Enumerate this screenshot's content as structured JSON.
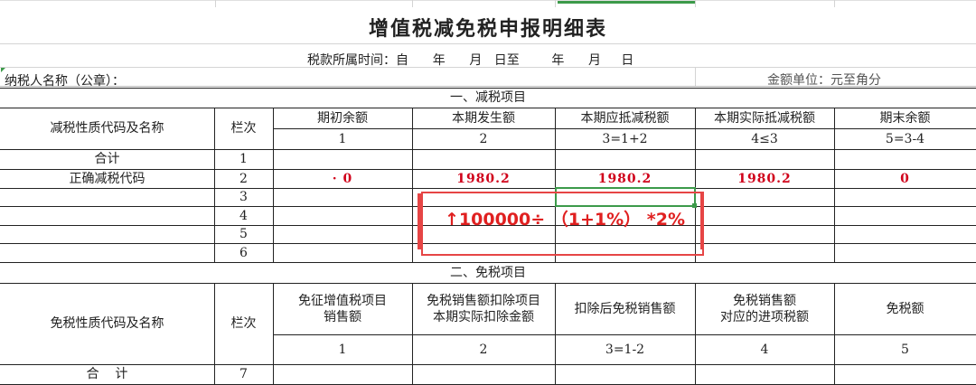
{
  "title": "增值税减免税申报明细表",
  "subtitle": "税款所属时间：自      年      月   日至        年      月     日",
  "taxpayer_label": "纳税人名称（公章）：",
  "unit_label": "金额单位：元至角分",
  "section1": {
    "title": "一、减税项目",
    "name_header": "减税性质代码及名称",
    "row_header": "栏次",
    "columns": [
      "期初余额",
      "本期发生额",
      "本期应抵减税额",
      "本期实际抵减税额",
      "期末余额"
    ],
    "formulas": [
      "1",
      "2",
      "3=1+2",
      "4≤3",
      "5=3-4"
    ],
    "rows": [
      {
        "name": "合计",
        "line": "1",
        "values": [
          "",
          "",
          "",
          "",
          ""
        ]
      },
      {
        "name": "正确减税代码",
        "line": "2",
        "values": [
          "· 0",
          "1980.2",
          "1980.2",
          "1980.2",
          "0"
        ]
      },
      {
        "name": "",
        "line": "3",
        "values": [
          "",
          "",
          "",
          "",
          ""
        ]
      },
      {
        "name": "",
        "line": "4",
        "values": [
          "",
          "",
          "",
          "",
          ""
        ]
      },
      {
        "name": "",
        "line": "5",
        "values": [
          "",
          "",
          "",
          "",
          ""
        ]
      },
      {
        "name": "",
        "line": "6",
        "values": [
          "",
          "",
          "",
          "",
          ""
        ]
      }
    ]
  },
  "section2": {
    "title": "二、免税项目",
    "name_header": "免税性质代码及名称",
    "row_header": "栏次",
    "columns": [
      "免征增值税项目\n销售额",
      "免税销售额扣除项目\n本期实际扣除金额",
      "扣除后免税销售额",
      "免税销售额\n对应的进项税额",
      "免税额"
    ],
    "formulas": [
      "1",
      "2",
      "3=1-2",
      "4",
      "5"
    ],
    "rows": [
      {
        "name": "合    计",
        "line": "7"
      }
    ]
  },
  "annotation": "↑100000÷ （1+1%） *2%",
  "colors": {
    "annotation_red": "#e02020",
    "value_red": "#d0021b",
    "selection_green": "#3c9a4a"
  }
}
